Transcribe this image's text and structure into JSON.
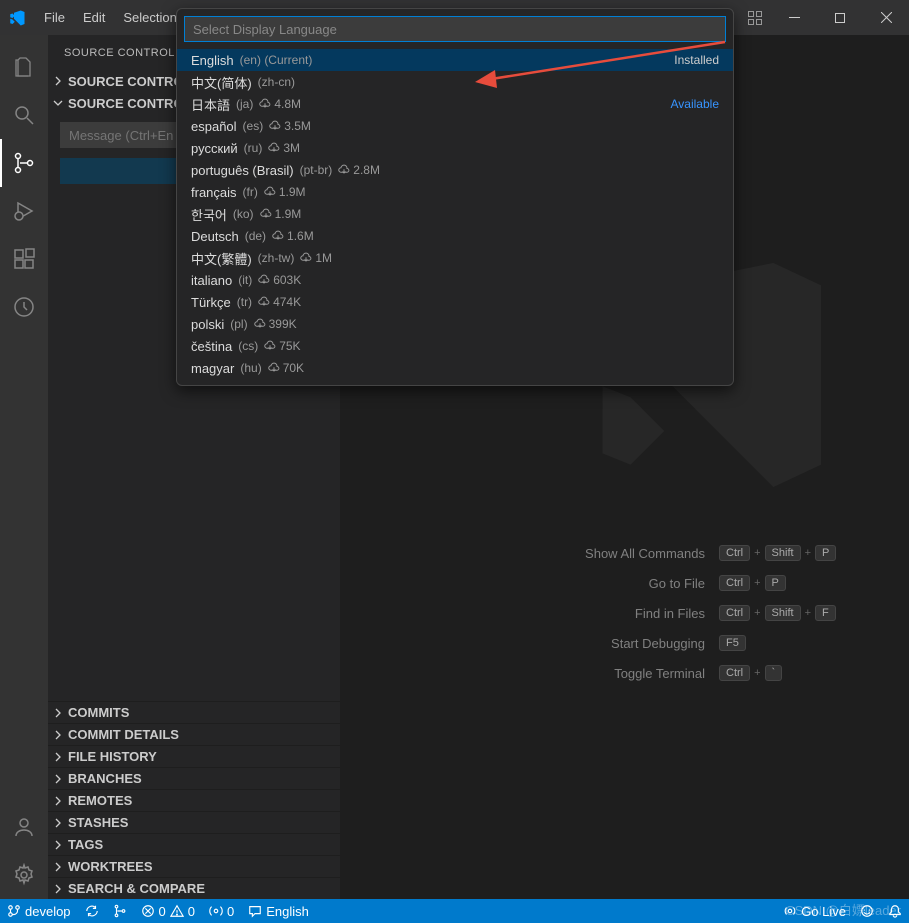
{
  "menubar": {
    "file": "File",
    "edit": "Edit",
    "selection": "Selection"
  },
  "quickpick": {
    "placeholder": "Select Display Language",
    "installed_tag": "Installed",
    "available_tag": "Available",
    "items": [
      {
        "name": "English",
        "code": "(en)",
        "extra": "(Current)",
        "tag": "installed"
      },
      {
        "name": "中文(简体)",
        "code": "(zh-cn)"
      },
      {
        "name": "日本語",
        "code": "(ja)",
        "downloads": "4.8M",
        "tag": "available"
      },
      {
        "name": "español",
        "code": "(es)",
        "downloads": "3.5M"
      },
      {
        "name": "русский",
        "code": "(ru)",
        "downloads": "3M"
      },
      {
        "name": "português (Brasil)",
        "code": "(pt-br)",
        "downloads": "2.8M"
      },
      {
        "name": "français",
        "code": "(fr)",
        "downloads": "1.9M"
      },
      {
        "name": "한국어",
        "code": "(ko)",
        "downloads": "1.9M"
      },
      {
        "name": "Deutsch",
        "code": "(de)",
        "downloads": "1.6M"
      },
      {
        "name": "中文(繁體)",
        "code": "(zh-tw)",
        "downloads": "1M"
      },
      {
        "name": "italiano",
        "code": "(it)",
        "downloads": "603K"
      },
      {
        "name": "Türkçe",
        "code": "(tr)",
        "downloads": "474K"
      },
      {
        "name": "polski",
        "code": "(pl)",
        "downloads": "399K"
      },
      {
        "name": "čeština",
        "code": "(cs)",
        "downloads": "75K"
      },
      {
        "name": "magyar",
        "code": "(hu)",
        "downloads": "70K"
      }
    ]
  },
  "sidebar": {
    "title": "SOURCE CONTROL",
    "repos_header": "SOURCE CONTROL R",
    "main_header": "SOURCE CONTROL",
    "message_placeholder": "Message (Ctrl+En",
    "sections": {
      "commits": "COMMITS",
      "commit_details": "COMMIT DETAILS",
      "file_history": "FILE HISTORY",
      "branches": "BRANCHES",
      "remotes": "REMOTES",
      "stashes": "STASHES",
      "tags": "TAGS",
      "worktrees": "WORKTREES",
      "search": "SEARCH & COMPARE"
    }
  },
  "shortcuts": {
    "show_all": "Show All Commands",
    "goto_file": "Go to File",
    "find_files": "Find in Files",
    "debug": "Start Debugging",
    "terminal": "Toggle Terminal",
    "keys": {
      "ctrl": "Ctrl",
      "shift": "Shift",
      "p": "P",
      "f": "F",
      "f5": "F5",
      "tick": "`"
    }
  },
  "statusbar": {
    "branch": "develop",
    "errors": "0",
    "warnings": "0",
    "ports": "0",
    "language": "English",
    "golive": "Go Live"
  },
  "watermark": "CSDN @白嫖leader"
}
